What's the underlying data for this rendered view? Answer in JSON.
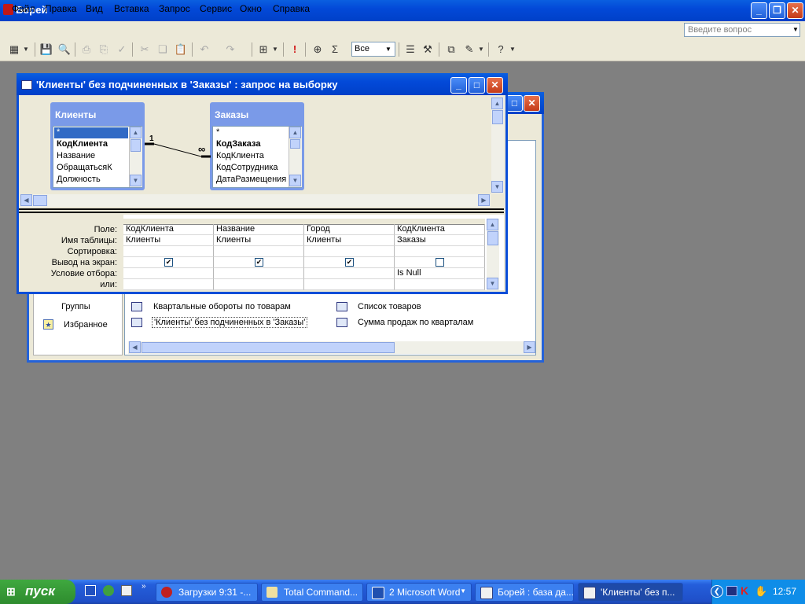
{
  "app": {
    "title": "Борей"
  },
  "menu": {
    "items": [
      "Файл",
      "Правка",
      "Вид",
      "Вставка",
      "Запрос",
      "Сервис",
      "Окно",
      "Справка"
    ],
    "ask_placeholder": "Введите вопрос"
  },
  "toolbar": {
    "combo_value": "Все",
    "sigma": "Σ",
    "run": "!"
  },
  "query_window": {
    "title": "'Клиенты' без подчиненных в 'Заказы' : запрос на выборку",
    "tables": [
      {
        "name": "Клиенты",
        "fields": [
          "*",
          "КодКлиента",
          "Название",
          "ОбращатьсяК",
          "Должность"
        ]
      },
      {
        "name": "Заказы",
        "fields": [
          "*",
          "КодЗаказа",
          "КодКлиента",
          "КодСотрудника",
          "ДатаРазмещения"
        ]
      }
    ],
    "relation": {
      "one": "1",
      "many": "∞"
    },
    "row_labels": [
      "Поле:",
      "Имя таблицы:",
      "Сортировка:",
      "Вывод на экран:",
      "Условие отбора:",
      "или:"
    ],
    "columns": [
      {
        "field": "КодКлиента",
        "table": "Клиенты",
        "sort": "",
        "show": true,
        "criteria": ""
      },
      {
        "field": "Название",
        "table": "Клиенты",
        "sort": "",
        "show": true,
        "criteria": ""
      },
      {
        "field": "Город",
        "table": "Клиенты",
        "sort": "",
        "show": true,
        "criteria": ""
      },
      {
        "field": "КодКлиента",
        "table": "Заказы",
        "sort": "",
        "show": false,
        "criteria": "Is Null"
      }
    ]
  },
  "db_window": {
    "side": [
      "Группы",
      "Избранное"
    ],
    "objects": [
      "Квартальные обороты по товарам",
      "'Клиенты' без подчиненных в 'Заказы'",
      "Список товаров",
      "Сумма продаж по кварталам"
    ]
  },
  "taskbar": {
    "start": "пуск",
    "tasks": [
      "Загрузки 9:31 -...",
      "Total Command...",
      "2 Microsoft Word",
      "Борей : база да...",
      "'Клиенты' без п..."
    ],
    "clock": "12:57"
  }
}
